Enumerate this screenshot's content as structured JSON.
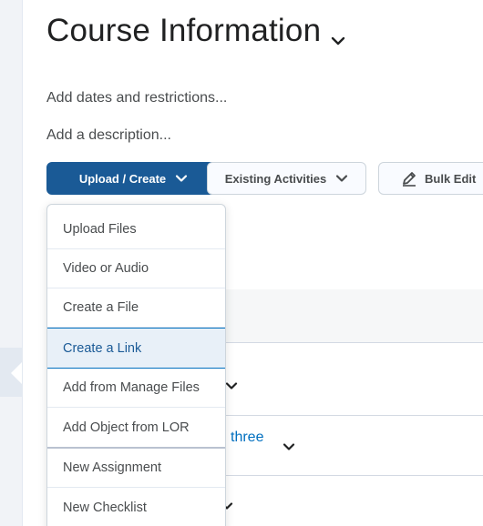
{
  "page": {
    "title": "Course Information",
    "dates_link": "Add dates and restrictions...",
    "description_link": "Add a description..."
  },
  "toolbar": {
    "upload_create_label": "Upload / Create",
    "existing_activities_label": "Existing Activities",
    "bulk_edit_label": "Bulk Edit"
  },
  "dropdown": {
    "items": [
      {
        "label": "Upload Files"
      },
      {
        "label": "Video or Audio"
      },
      {
        "label": "Create a File"
      },
      {
        "label": "Create a Link",
        "highlighted": true
      },
      {
        "label": "Add from Manage Files"
      },
      {
        "label": "Add Object from LOR"
      },
      {
        "label": "New Assignment"
      },
      {
        "label": "New Checklist"
      }
    ]
  },
  "background": {
    "partial_link_text": "three"
  },
  "icons": {
    "title_chevron": "chevron-down-icon",
    "button_chevron": "chevron-down-icon",
    "bulk_edit": "pencil-icon",
    "side_collapse": "caret-left-icon"
  },
  "colors": {
    "primary": "#1a5a96",
    "link": "#006fbf",
    "highlight_bg": "#e8f0f8",
    "text": "#494c4e"
  }
}
